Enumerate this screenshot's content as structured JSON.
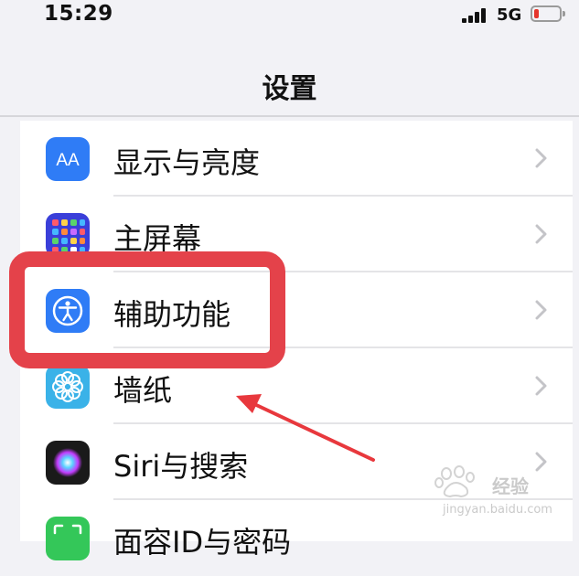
{
  "status_bar": {
    "time": "15:29",
    "network": "5G",
    "battery_level": 0.1,
    "battery_color": "#e5352c"
  },
  "nav": {
    "title": "设置"
  },
  "settings": {
    "items": [
      {
        "label": "显示与亮度",
        "icon": "display-brightness-icon"
      },
      {
        "label": "主屏幕",
        "icon": "home-screen-icon"
      },
      {
        "label": "辅助功能",
        "icon": "accessibility-icon"
      },
      {
        "label": "墙纸",
        "icon": "wallpaper-icon"
      },
      {
        "label": "Siri与搜索",
        "icon": "siri-icon"
      },
      {
        "label": "面容ID与密码",
        "icon": "face-id-icon"
      }
    ]
  },
  "icons": {
    "display_text": "AA"
  },
  "annotation": {
    "highlight_color": "#e4424a"
  },
  "watermark": {
    "brand": "经验",
    "url": "jingyan.baidu.com"
  }
}
